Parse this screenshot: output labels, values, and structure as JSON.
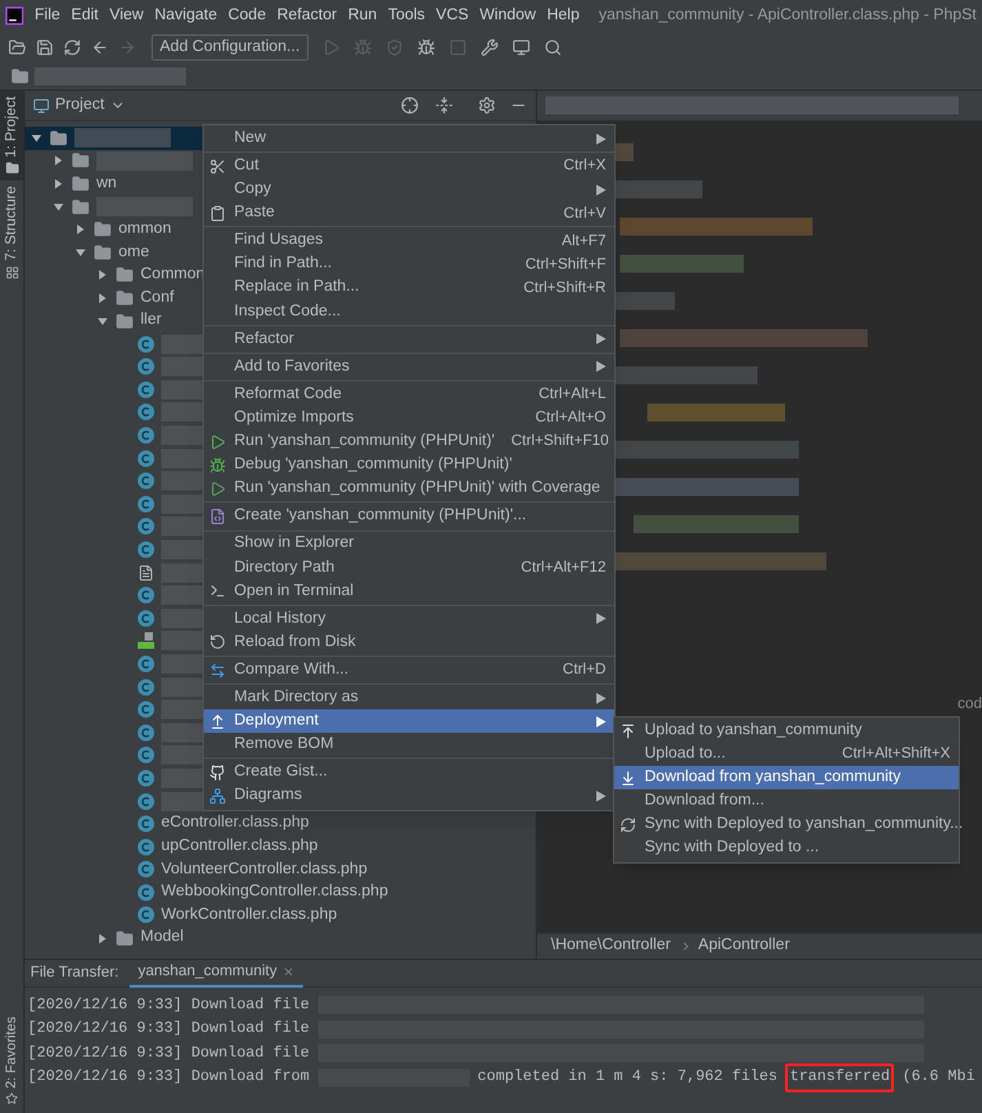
{
  "menubar": {
    "items": [
      "File",
      "Edit",
      "View",
      "Navigate",
      "Code",
      "Refactor",
      "Run",
      "Tools",
      "VCS",
      "Window",
      "Help"
    ],
    "title": "yanshan_community - ApiController.class.php - PhpSt"
  },
  "toolbar": {
    "left": [
      {
        "kind": "open",
        "disabled": false
      },
      {
        "kind": "save",
        "disabled": false
      },
      {
        "kind": "sync",
        "disabled": false
      },
      {
        "kind": "back",
        "disabled": false
      },
      {
        "kind": "forward",
        "disabled": true
      }
    ],
    "config_button": "Add Configuration...",
    "right": [
      {
        "kind": "run",
        "disabled": true
      },
      {
        "kind": "debug",
        "disabled": true
      },
      {
        "kind": "coverage",
        "disabled": true
      },
      {
        "kind": "attach",
        "disabled": false
      },
      {
        "kind": "stop",
        "disabled": true
      },
      {
        "kind": "wrench",
        "disabled": false
      },
      {
        "kind": "window",
        "disabled": false
      },
      {
        "kind": "search",
        "disabled": false
      }
    ]
  },
  "side_tabs": [
    {
      "label": "1: Project",
      "selected": true,
      "kind": "project"
    },
    {
      "label": "7: Structure",
      "selected": false,
      "kind": "structure"
    }
  ],
  "bottom_side_tab": {
    "label": "2: Favorites",
    "selected": false
  },
  "project_panel": {
    "title": "Project",
    "tree": [
      {
        "kind": "folder",
        "expanded": true,
        "selected": true,
        "children": [
          {
            "kind": "folder",
            "expanded": false
          },
          {
            "kind": "folder",
            "name": "wn",
            "expanded": false
          },
          {
            "kind": "folder",
            "expanded": true,
            "children": [
              {
                "kind": "folder",
                "name": "ommon",
                "expanded": false
              },
              {
                "kind": "folder",
                "name": "ome",
                "expanded": true,
                "children": [
                  {
                    "kind": "folder",
                    "name": "Common",
                    "expanded": false
                  },
                  {
                    "kind": "folder",
                    "name": "Conf",
                    "expanded": false
                  },
                  {
                    "kind": "folder",
                    "name": "ller",
                    "expanded": true,
                    "children": [
                      {
                        "kind": "class"
                      },
                      {
                        "kind": "class"
                      },
                      {
                        "kind": "class"
                      },
                      {
                        "kind": "class"
                      },
                      {
                        "kind": "class"
                      },
                      {
                        "kind": "class"
                      },
                      {
                        "kind": "class"
                      },
                      {
                        "kind": "class"
                      },
                      {
                        "kind": "class"
                      },
                      {
                        "kind": "class"
                      },
                      {
                        "kind": "doc"
                      },
                      {
                        "kind": "class"
                      },
                      {
                        "kind": "class"
                      },
                      {
                        "kind": "html"
                      },
                      {
                        "kind": "class"
                      },
                      {
                        "kind": "class"
                      },
                      {
                        "kind": "class"
                      },
                      {
                        "kind": "class"
                      },
                      {
                        "kind": "class"
                      },
                      {
                        "kind": "class"
                      },
                      {
                        "kind": "class"
                      },
                      {
                        "kind": "class",
                        "name": "eController.class.php"
                      },
                      {
                        "kind": "class",
                        "name": "upController.class.php"
                      },
                      {
                        "kind": "class",
                        "name": "VolunteerController.class.php"
                      },
                      {
                        "kind": "class",
                        "name": "WebbookingController.class.php"
                      },
                      {
                        "kind": "class",
                        "name": "WorkController.class.php"
                      }
                    ]
                  },
                  {
                    "kind": "folder",
                    "name": "Model",
                    "expanded": false
                  }
                ]
              }
            ]
          }
        ]
      }
    ]
  },
  "editor": {
    "partial_text": "cod",
    "breadcrumbs": [
      "\\Home\\Controller",
      "ApiController"
    ]
  },
  "context_menu": {
    "groups": [
      [
        {
          "label": "New",
          "kind": "plain",
          "submenu": true,
          "selected": false
        }
      ],
      [
        {
          "label": "Cut",
          "kind": "cut",
          "shortcut": "Ctrl+X",
          "selected": false
        },
        {
          "label": "Copy",
          "kind": "plain",
          "submenu": true,
          "selected": false
        },
        {
          "label": "Paste",
          "kind": "paste",
          "shortcut": "Ctrl+V",
          "selected": false
        }
      ],
      [
        {
          "label": "Find Usages",
          "kind": "plain",
          "shortcut": "Alt+F7",
          "selected": false
        },
        {
          "label": "Find in Path...",
          "kind": "plain",
          "shortcut": "Ctrl+Shift+F",
          "selected": false
        },
        {
          "label": "Replace in Path...",
          "kind": "plain",
          "shortcut": "Ctrl+Shift+R",
          "selected": false
        },
        {
          "label": "Inspect Code...",
          "kind": "plain",
          "selected": false
        }
      ],
      [
        {
          "label": "Refactor",
          "kind": "plain",
          "submenu": true,
          "selected": false
        }
      ],
      [
        {
          "label": "Add to Favorites",
          "kind": "plain",
          "submenu": true,
          "selected": false
        }
      ],
      [
        {
          "label": "Reformat Code",
          "kind": "plain",
          "shortcut": "Ctrl+Alt+L",
          "selected": false
        },
        {
          "label": "Optimize Imports",
          "kind": "plain",
          "shortcut": "Ctrl+Alt+O",
          "selected": false
        },
        {
          "label": "Run 'yanshan_community (PHPUnit)'",
          "kind": "run",
          "shortcut": "Ctrl+Shift+F10",
          "selected": false
        },
        {
          "label": "Debug 'yanshan_community (PHPUnit)'",
          "kind": "debug",
          "selected": false
        },
        {
          "label": "Run 'yanshan_community (PHPUnit)' with Coverage",
          "kind": "coverage",
          "selected": false
        }
      ],
      [
        {
          "label": "Create 'yanshan_community (PHPUnit)'...",
          "kind": "phpunit",
          "selected": false
        }
      ],
      [
        {
          "label": "Show in Explorer",
          "kind": "plain",
          "selected": false
        },
        {
          "label": "Directory Path",
          "kind": "plain",
          "shortcut": "Ctrl+Alt+F12",
          "selected": false
        },
        {
          "label": "Open in Terminal",
          "kind": "terminal",
          "selected": false
        }
      ],
      [
        {
          "label": "Local History",
          "kind": "plain",
          "submenu": true,
          "selected": false
        },
        {
          "label": "Reload from Disk",
          "kind": "reload",
          "selected": false
        }
      ],
      [
        {
          "label": "Compare With...",
          "kind": "compare",
          "shortcut": "Ctrl+D",
          "selected": false
        }
      ],
      [
        {
          "label": "Mark Directory as",
          "kind": "plain",
          "submenu": true,
          "selected": false
        },
        {
          "label": "Deployment",
          "kind": "deploy",
          "submenu": true,
          "selected": true
        },
        {
          "label": "Remove BOM",
          "kind": "plain",
          "selected": false
        }
      ],
      [
        {
          "label": "Create Gist...",
          "kind": "gist",
          "selected": false
        },
        {
          "label": "Diagrams",
          "kind": "diagrams",
          "submenu": true,
          "selected": false
        }
      ]
    ]
  },
  "submenu": {
    "items": [
      {
        "label": "Upload to yanshan_community",
        "kind": "upload",
        "selected": false
      },
      {
        "label": "Upload to...",
        "kind": "plain",
        "shortcut": "Ctrl+Alt+Shift+X",
        "selected": false
      },
      {
        "label": "Download from yanshan_community",
        "kind": "download",
        "selected": true
      },
      {
        "label": "Download from...",
        "kind": "plain",
        "selected": false
      },
      {
        "label": "Sync with Deployed to yanshan_community...",
        "kind": "sync",
        "selected": false
      },
      {
        "label": "Sync with Deployed to ...",
        "kind": "plain",
        "selected": false
      }
    ]
  },
  "file_transfer": {
    "label": "File Transfer:",
    "tabs": [
      {
        "label": "yanshan_community",
        "selected": true
      }
    ],
    "lines": [
      {
        "text": "[2020/12/16 9:33] Download file"
      },
      {
        "text": "[2020/12/16 9:33] Download file"
      },
      {
        "text": "[2020/12/16 9:33] Download file"
      },
      {
        "text": "[2020/12/16 9:33] Download from",
        "tail": [
          {
            "text": "completed in 1 m 4 s: 7,962 files",
            "highlighted": false
          },
          {
            "text": "transferred",
            "highlighted": true
          },
          {
            "text": "(6.6 Mbi",
            "highlighted": false
          }
        ]
      }
    ]
  }
}
